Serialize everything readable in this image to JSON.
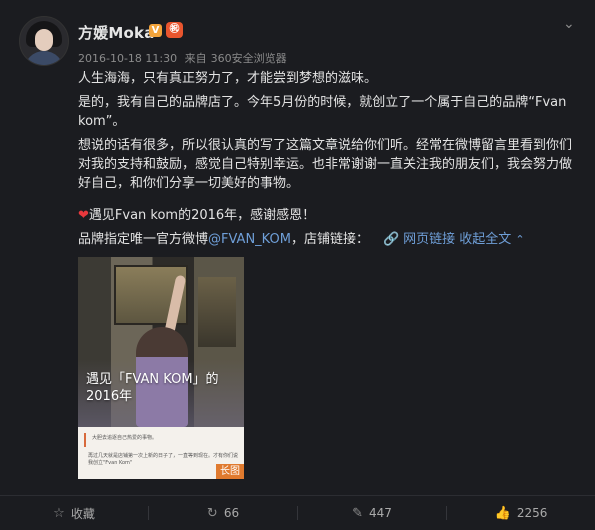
{
  "user": {
    "name": "方媛Moka",
    "verified_badge": "V",
    "vip_badge": "㊗"
  },
  "meta": {
    "timestamp": "2016-10-18 11:30",
    "source_prefix": "来自",
    "source": "360安全浏览器"
  },
  "post": {
    "line1": "人生海海，只有真正努力了，才能尝到梦想的滋味。",
    "line2": "是的，我有自己的品牌店了。今年5月份的时候，就创立了一个属于自己的品牌“Fvan kom”。",
    "line3": "想说的话有很多，所以很认真的写了这篇文章说给你们听。经常在微博留言里看到你们对我的支持和鼓励，感觉自己特别幸运。也非常谢谢一直关注我的朋友们，我会努力做好自己，和你们分享一切美好的事物。",
    "line4_heart": "❤",
    "line4": "遇见Fvan kom的2016年，感谢感恩！",
    "line5_prefix": "品牌指定唯一官方微博",
    "mention": "@FVAN_KOM",
    "line5_mid": "，店铺链接：",
    "web_link": "网页链接",
    "collapse": "收起全文"
  },
  "thumbnail": {
    "caption_line1": "遇见「FVAN KOM」的",
    "caption_line2": "2016年",
    "paper_line1": "大胆去追逐自己热爱的事物。",
    "paper_line2": "再过几天就是店铺第一次上新的日子了，一直等到现在。才有你们说我创立\"Fvan Kom\"",
    "tag": "长图"
  },
  "actions": {
    "favorite": "收藏",
    "repost": "66",
    "comment": "447",
    "like": "2256"
  },
  "colors": {
    "background": "#1b1c20",
    "link": "#6f9fd8",
    "heart": "#e8383d",
    "tag": "#e07a2e"
  }
}
